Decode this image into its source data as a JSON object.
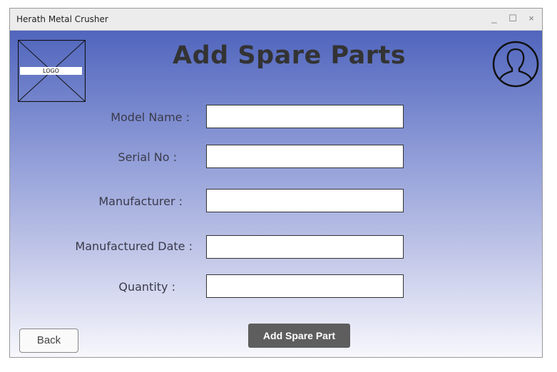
{
  "window": {
    "title": "Herath Metal Crusher",
    "minimize_glyph": "_",
    "maximize_glyph": "☐",
    "close_glyph": "×"
  },
  "logo": {
    "label": "LOGO"
  },
  "header": {
    "title": "Add Spare Parts",
    "avatar_icon": "user-icon"
  },
  "form": {
    "fields": [
      {
        "label": "Model Name :",
        "value": "",
        "placeholder": ""
      },
      {
        "label": "Serial No :",
        "value": "",
        "placeholder": ""
      },
      {
        "label": "Manufacturer :",
        "value": "",
        "placeholder": ""
      },
      {
        "label": "Manufactured Date :",
        "value": "",
        "placeholder": ""
      },
      {
        "label": "Quantity :",
        "value": "",
        "placeholder": ""
      }
    ],
    "submit_label": "Add Spare Part"
  },
  "footer": {
    "back_label": "Back"
  },
  "colors": {
    "gradient_top": "#5065bd",
    "gradient_bottom": "#f7f7fc",
    "submit_button": "#5e5e5e"
  }
}
